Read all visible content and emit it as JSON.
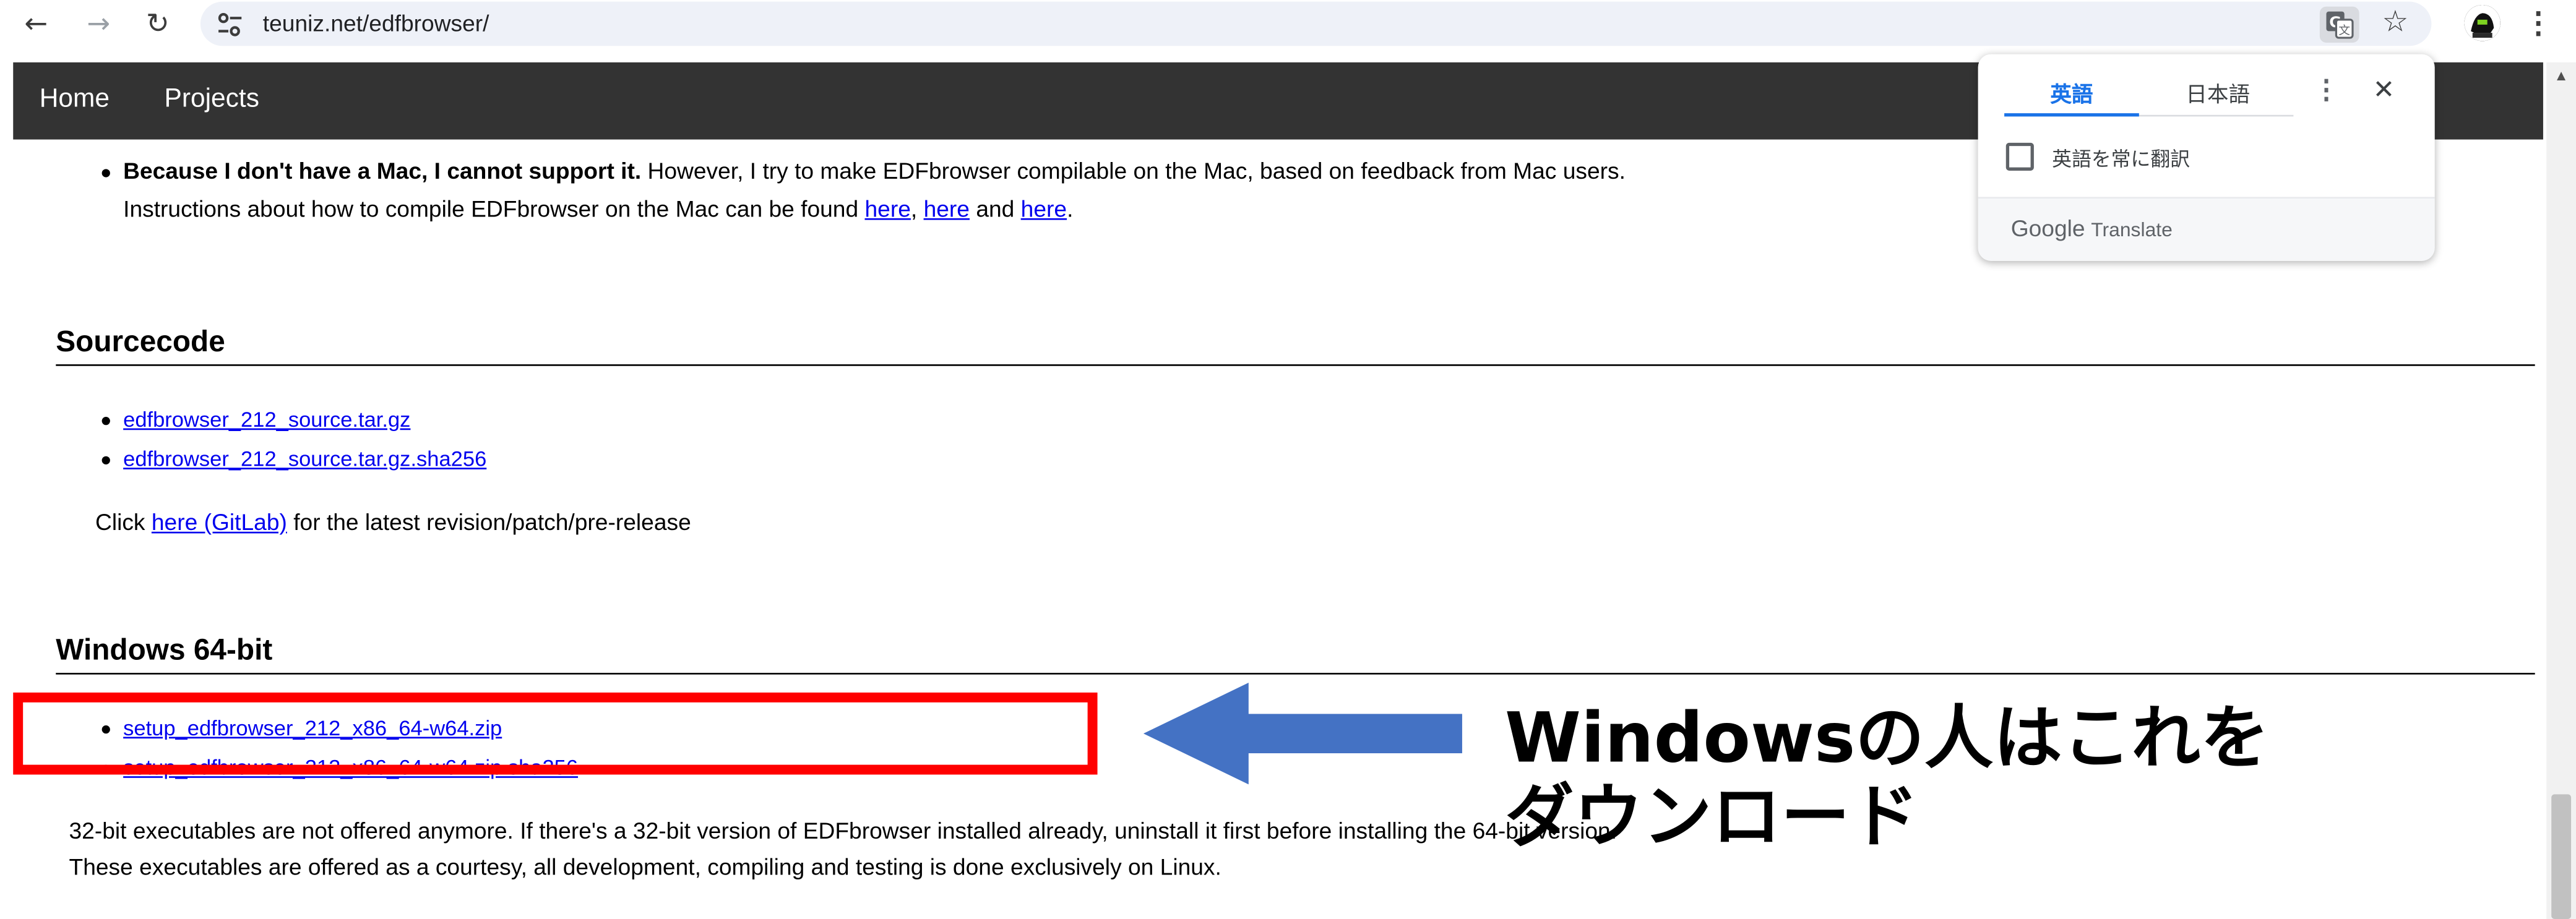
{
  "browser": {
    "url": "teuniz.net/edfbrowser/",
    "back_icon": "←",
    "forward_icon": "→",
    "reload_icon": "↻",
    "star_icon": "☆",
    "menu_icon": "⋮"
  },
  "site_nav": {
    "items": [
      "Home",
      "Projects"
    ]
  },
  "mac_note": {
    "bold": "Because I don't have a Mac, I cannot support it.",
    "rest": " However, I try to make EDFbrowser compilable on the Mac, based on feedback from Mac users.",
    "line2_prefix": "Instructions about how to compile EDFbrowser on the Mac can be found ",
    "link1": "here",
    "sep1": ", ",
    "link2": "here",
    "sep2": " and ",
    "link3": "here",
    "end": "."
  },
  "sourcecode": {
    "heading": "Sourcecode",
    "files": [
      "edfbrowser_212_source.tar.gz",
      "edfbrowser_212_source.tar.gz.sha256"
    ],
    "click_prefix": "Click ",
    "gitlab_link": "here (GitLab)",
    "click_suffix": " for the latest revision/patch/pre-release"
  },
  "windows": {
    "heading": "Windows 64-bit",
    "files": [
      "setup_edfbrowser_212_x86_64-w64.zip",
      "setup_edfbrowser_212_x86_64-w64.zip.sha256"
    ],
    "note1": "32-bit executables are not offered anymore. If there's a 32-bit version of EDFbrowser installed already, uninstall it first before installing the 64-bit version.",
    "note2": "These executables are offered as a courtesy, all development, compiling and testing is done exclusively on Linux."
  },
  "translate_popup": {
    "tab_source": "英語",
    "tab_target": "日本語",
    "always_translate": "英語を常に翻訳",
    "always_translate_checked": false,
    "more_icon": "⋮",
    "close_icon": "✕",
    "brand": "Google",
    "product": "Translate"
  },
  "annotation": {
    "line1": "Windowsの人はこれを",
    "line2": "ダウンロード",
    "arrow_color": "#4472c4",
    "box_color": "#ff0000"
  }
}
